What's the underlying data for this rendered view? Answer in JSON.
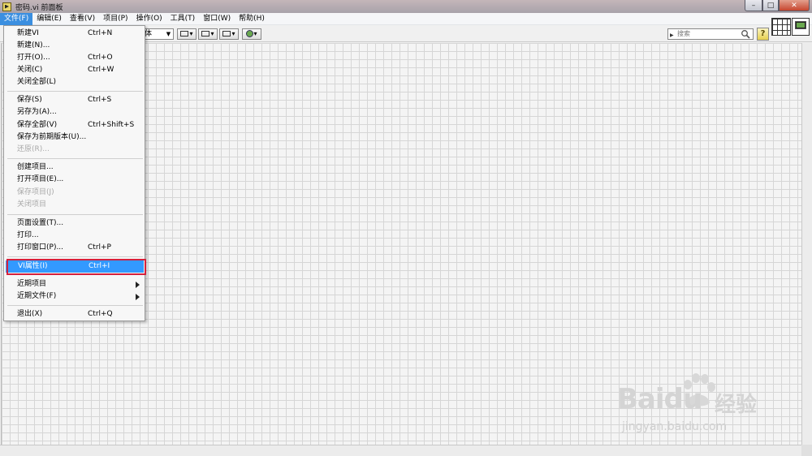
{
  "window": {
    "title": "密码.vi 前面板",
    "minimize_symbol": "–",
    "maximize_symbol": "□",
    "close_symbol": "✕"
  },
  "menubar": {
    "items": [
      "文件(F)",
      "编辑(E)",
      "查看(V)",
      "项目(P)",
      "操作(O)",
      "工具(T)",
      "窗口(W)",
      "帮助(H)"
    ]
  },
  "toolbar": {
    "font_label": "体",
    "search_placeholder": "搜索",
    "help_label": "?"
  },
  "file_menu": {
    "items": [
      {
        "label": "新建VI",
        "shortcut": "Ctrl+N"
      },
      {
        "label": "新建(N)...",
        "shortcut": ""
      },
      {
        "label": "打开(O)...",
        "shortcut": "Ctrl+O"
      },
      {
        "label": "关闭(C)",
        "shortcut": "Ctrl+W"
      },
      {
        "label": "关闭全部(L)",
        "shortcut": ""
      },
      {
        "label": "保存(S)",
        "shortcut": "Ctrl+S"
      },
      {
        "label": "另存为(A)...",
        "shortcut": ""
      },
      {
        "label": "保存全部(V)",
        "shortcut": "Ctrl+Shift+S"
      },
      {
        "label": "保存为前期版本(U)...",
        "shortcut": ""
      },
      {
        "label": "还原(R)...",
        "shortcut": ""
      },
      {
        "label": "创建项目...",
        "shortcut": ""
      },
      {
        "label": "打开项目(E)...",
        "shortcut": ""
      },
      {
        "label": "保存项目(J)",
        "shortcut": ""
      },
      {
        "label": "关闭项目",
        "shortcut": ""
      },
      {
        "label": "页面设置(T)...",
        "shortcut": ""
      },
      {
        "label": "打印...",
        "shortcut": ""
      },
      {
        "label": "打印窗口(P)...",
        "shortcut": "Ctrl+P"
      },
      {
        "label": "VI属性(I)",
        "shortcut": "Ctrl+I"
      },
      {
        "label": "近期项目",
        "shortcut": ""
      },
      {
        "label": "近期文件(F)",
        "shortcut": ""
      },
      {
        "label": "退出(X)",
        "shortcut": "Ctrl+Q"
      }
    ],
    "highlight_color": "#3399ff",
    "annotation_color": "#d4213d"
  },
  "watermark": {
    "logo": "Baidu",
    "product": "经验",
    "url": "jingyan.baidu.com"
  }
}
